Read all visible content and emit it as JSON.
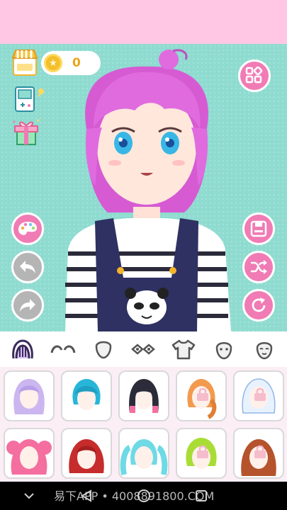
{
  "coins": {
    "value": "0"
  },
  "watermark": "易下APP • 4008891800.COM",
  "categories": [
    "hair-style",
    "eyebrows",
    "face-shape",
    "eyes",
    "top-clothing",
    "face",
    "expression"
  ],
  "colors": {
    "accent_pink": "#f07bb5",
    "stage_bg": "#8fdbd0",
    "top_band": "#ffc7e4",
    "coin_gold": "#f4bf2c"
  },
  "items": [
    {
      "name": "lavender-long-hair",
      "color": "#cbb6f0",
      "locked": false
    },
    {
      "name": "teal-short-hair",
      "color": "#28b6d8",
      "locked": false
    },
    {
      "name": "black-pink-bob-hair",
      "color": "#2b2b3a",
      "locked": false
    },
    {
      "name": "orange-braid-hair",
      "color": "#f29a4e",
      "locked": true
    },
    {
      "name": "white-blue-hair",
      "color": "#e8f2ff",
      "locked": true
    },
    {
      "name": "pink-twin-tails-hair",
      "color": "#f46f9f",
      "locked": false
    },
    {
      "name": "red-wavy-hair",
      "color": "#c62c2c",
      "locked": false
    },
    {
      "name": "aqua-twin-tails-hair",
      "color": "#6fd9e6",
      "locked": false
    },
    {
      "name": "lime-short-hair",
      "color": "#a9dd36",
      "locked": true
    },
    {
      "name": "auburn-long-hair",
      "color": "#b5532c",
      "locked": true
    }
  ]
}
